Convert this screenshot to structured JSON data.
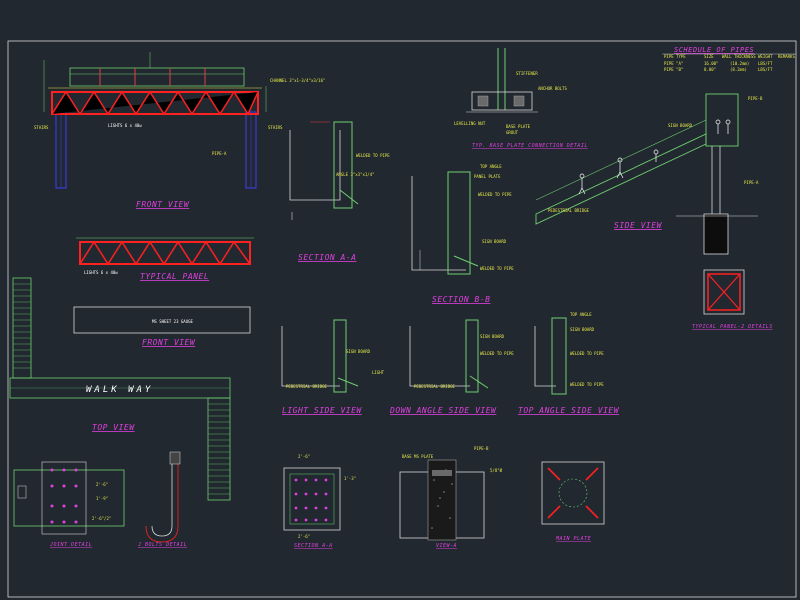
{
  "titles": {
    "front_view_top": "FRONT VIEW",
    "typical_panel": "TYPICAL PANEL",
    "front_view_mid": "FRONT VIEW",
    "top_view": "TOP VIEW",
    "section_aa": "SECTION A-A",
    "section_bb": "SECTION B-B",
    "light_side_view": "LIGHT SIDE VIEW",
    "down_angle_side_view": "DOWN ANGLE SIDE VIEW",
    "top_angle_side_view": "TOP ANGLE SIDE VIEW",
    "side_view": "SIDE VIEW",
    "typical_panel_details": "TYPICAL PANEL-2 DETAILS",
    "joint_detail": "JOINT DETAIL",
    "j_bolts_detail": "J BOLTS DETAIL",
    "section_aa_bottom": "SECTION A-A",
    "view_a": "VIEW-A",
    "main_plate": "MAIN PLATE",
    "base_plate_detail": "TYP. BASE PLATE CONNECTION DETAIL"
  },
  "labels": {
    "walkway": "WALK WAY",
    "ms_sheet_gauge": "MS SHEET 23 GAUGE",
    "pipe_a": "PIPE-A",
    "pipe_b": "PIPE-B",
    "stairs": "STAIRS",
    "lights": "LIGHTS 6 x 40w",
    "channel": "CHANNEL 3\"x1-3/4\"x3/16\"",
    "welded_to_pipe": "WELDED TO PIPE",
    "angle": "ANGLE 3\"x3\"x1/4\"",
    "top_angle": "TOP ANGLE",
    "panel_plate": "PANEL PLATE",
    "sign_board": "SIGN BOARD",
    "pedestrial_bridge": "PEDESTRIAL BRIDGE",
    "light": "LIGHT",
    "stiffener": "STIFFENER",
    "leveling_nut": "LEVELLING NUT",
    "anchor_bolts": "ANCHOR BOLTS",
    "base_plate": "BASE PLATE",
    "grout": "GROUT",
    "base_ms_plate": "BASE MS PLATE"
  },
  "schedule": {
    "title": "SCHEDULE OF PIPES",
    "headers": [
      "PIPE TYPE",
      "SIZE",
      "WALL THICKNESS",
      "WEIGHT",
      "REMARKS"
    ],
    "rows": [
      [
        "PIPE \"A\"",
        "16.00\"",
        "(10.2mm)",
        "LBS/FT",
        ""
      ],
      [
        "PIPE \"B\"",
        "8.00\"",
        "(8.2mm)",
        "LBS/FT",
        ""
      ]
    ]
  },
  "dimensions": {
    "dim_1": "2'-6\"",
    "dim_2": "1'-9\"",
    "dim_3": "2'-6\"/2\"",
    "dim_4": "1'-3\"",
    "dim_5": "5/8\"Ø"
  }
}
